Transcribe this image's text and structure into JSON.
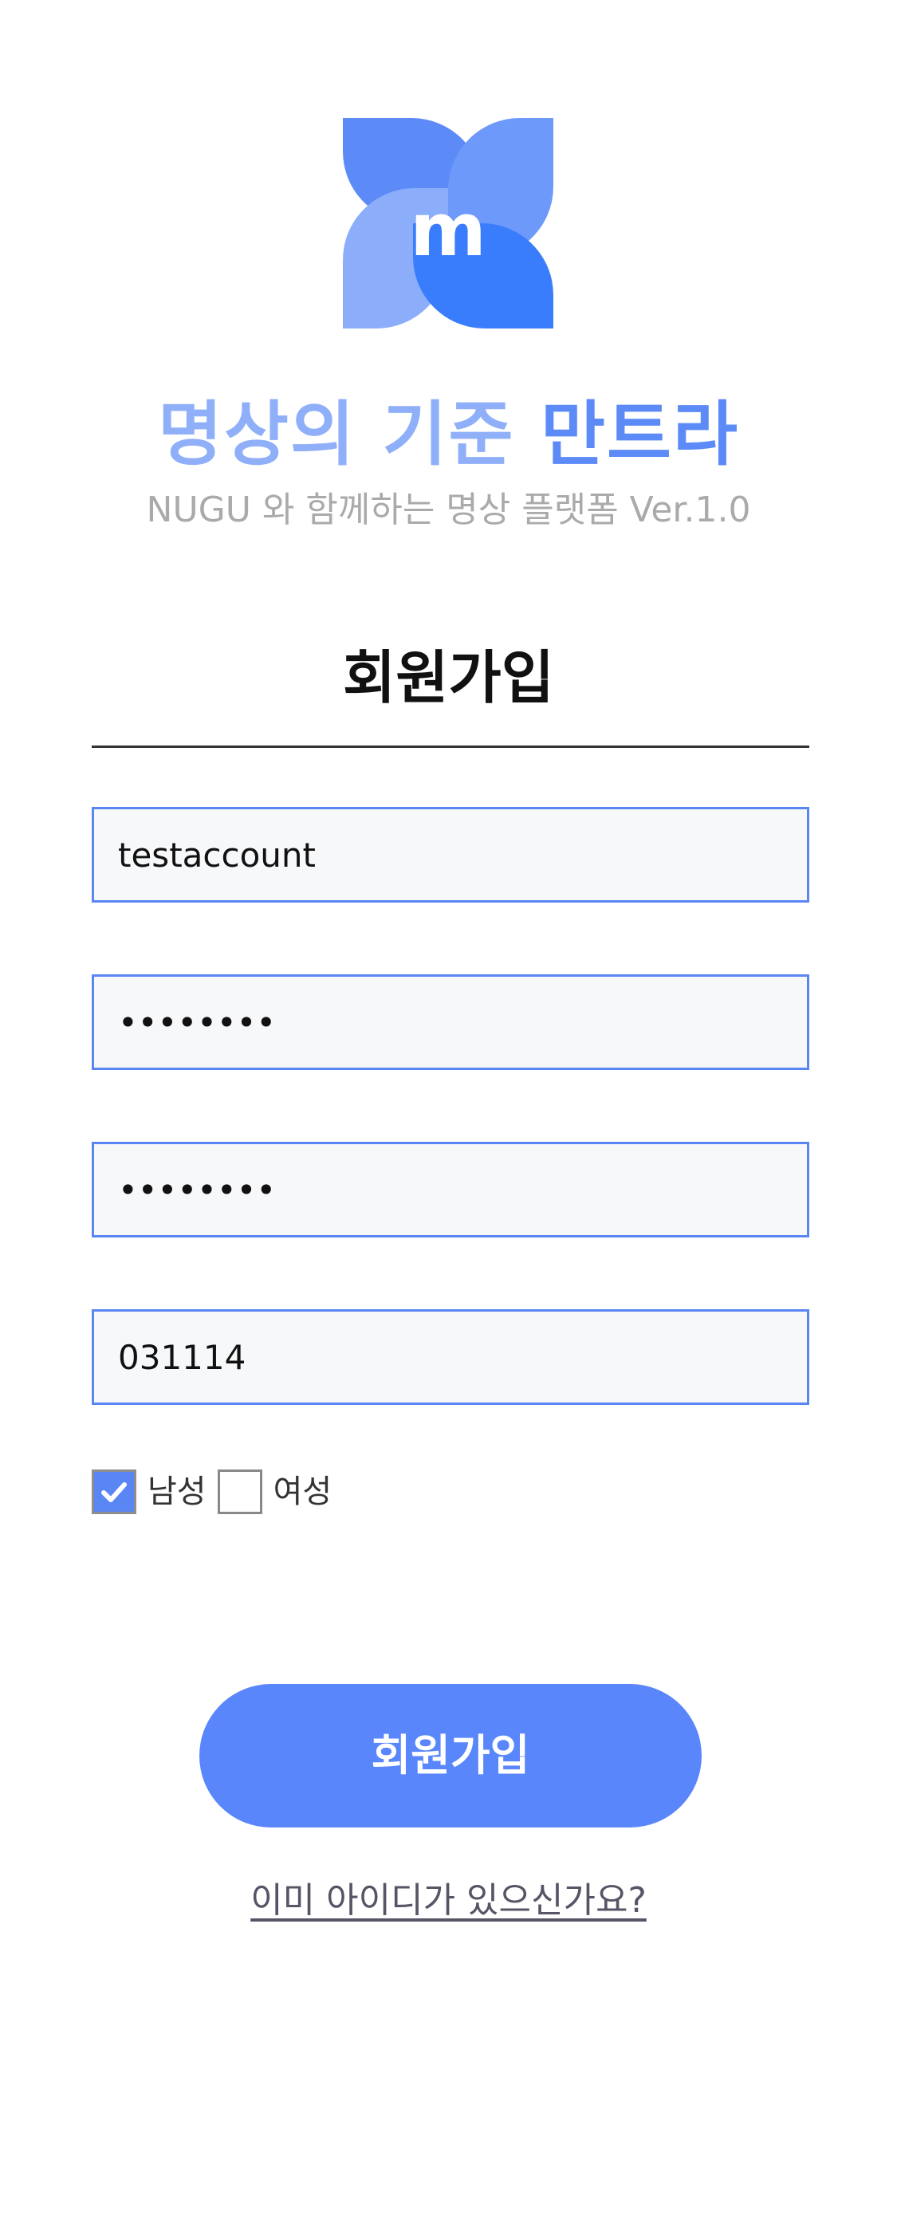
{
  "brand": {
    "logo_icon": "mantra-flower-logo",
    "logo_letter": "m",
    "title_part1": "명상의 기준",
    "title_part2": "만트라",
    "subtitle": "NUGU 와 함께하는 명상 플랫폼 Ver.1.0"
  },
  "page": {
    "title": "회원가입"
  },
  "form": {
    "id_value": "testaccount",
    "password_value": "12345678",
    "password_confirm_value": "12345678",
    "birth_value": "031114",
    "gender": {
      "male_label": "남성",
      "female_label": "여성",
      "male_checked": true,
      "female_checked": false
    }
  },
  "actions": {
    "signup_label": "회원가입",
    "login_link_label": "이미 아이디가 있으신가요?"
  },
  "colors": {
    "accent": "#5a86fc",
    "field_border": "#5a86f4",
    "title_light": "#8fb0f8",
    "title_strong": "#5c8bf8",
    "subtitle": "#aaaaaa"
  }
}
